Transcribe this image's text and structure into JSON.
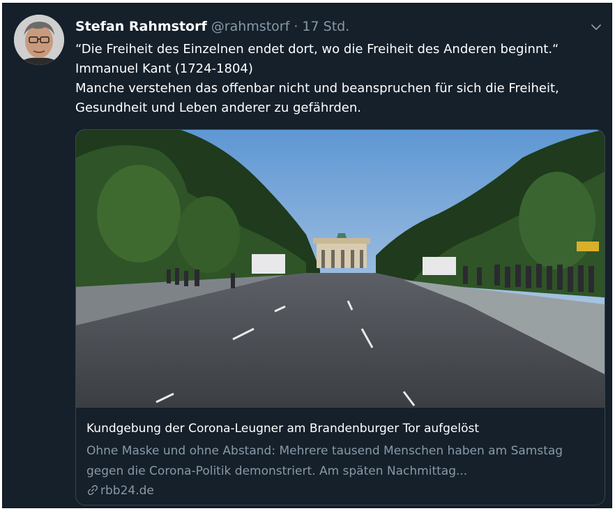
{
  "tweet": {
    "author_name": "Stefan Rahmstorf",
    "handle": "@rahmstorf",
    "separator": "·",
    "time": "17 Std.",
    "avatar_icon": "avatar-photo",
    "menu_icon": "chevron-down-icon",
    "lines": [
      "“Die Freiheit des Einzelnen endet dort, wo die Freiheit des Anderen beginnt.“",
      "Immanuel Kant (1724-1804)",
      "Manche verstehen das offenbar nicht und beanspruchen für sich die Freiheit, Gesundheit und Leben anderer zu gefährden."
    ]
  },
  "card": {
    "image_icon": "brandenburg-gate-photo",
    "title": "Kundgebung der Corona-Leugner am Brandenburger Tor aufgelöst",
    "description": "Ohne Maske und ohne Abstand: Mehrere tausend Menschen haben am Samstag gegen die Corona-Politik demonstriert. Am späten Nachmittag...",
    "domain": "rbb24.de",
    "link_icon": "link-icon"
  },
  "colors": {
    "background": "#15202b",
    "text_primary": "#ffffff",
    "text_secondary": "#8899a6",
    "border": "#38444d"
  }
}
